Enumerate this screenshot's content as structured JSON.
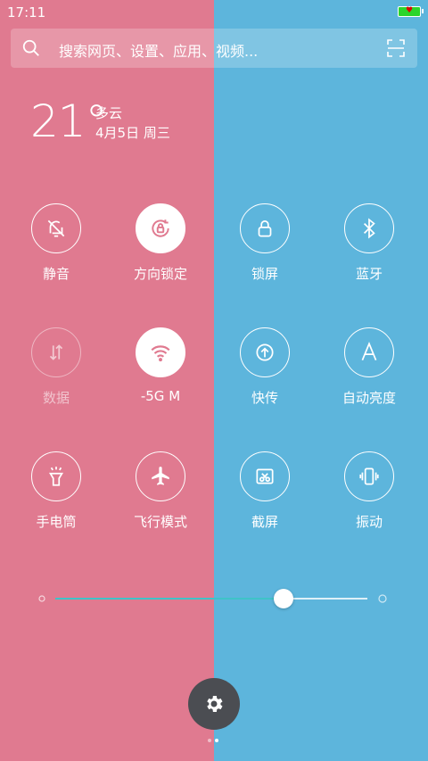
{
  "status_bar": {
    "time": "17:11",
    "battery_color": "#2bd52b"
  },
  "search": {
    "placeholder": "搜索网页、设置、应用、视频..."
  },
  "weather": {
    "temperature": "21°",
    "condition": "多云",
    "date": "4月5日 周三"
  },
  "tiles": [
    {
      "label": "静音",
      "icon": "bell-off-icon",
      "active": false
    },
    {
      "label": "方向锁定",
      "icon": "rotation-lock-icon",
      "active": true
    },
    {
      "label": "锁屏",
      "icon": "lock-icon",
      "active": false
    },
    {
      "label": "蓝牙",
      "icon": "bluetooth-icon",
      "active": false
    },
    {
      "label": "数据",
      "icon": "data-arrows-icon",
      "active": false,
      "disabled": true
    },
    {
      "label": "-5G M",
      "icon": "wifi-icon",
      "active": true
    },
    {
      "label": "快传",
      "icon": "quick-transfer-icon",
      "active": false
    },
    {
      "label": "自动亮度",
      "icon": "auto-brightness-icon",
      "active": false
    },
    {
      "label": "手电筒",
      "icon": "flashlight-icon",
      "active": false
    },
    {
      "label": "飞行模式",
      "icon": "airplane-icon",
      "active": false
    },
    {
      "label": "截屏",
      "icon": "screenshot-icon",
      "active": false
    },
    {
      "label": "振动",
      "icon": "vibrate-icon",
      "active": false
    }
  ],
  "brightness": {
    "level": 0.73,
    "accent_color": "#3fc3c8"
  },
  "pager": {
    "current": 2,
    "total": 2
  },
  "colors": {
    "left_panel": "#e07a90",
    "right_panel": "#5db5dc",
    "active_icon_pink": "#e07a90"
  }
}
